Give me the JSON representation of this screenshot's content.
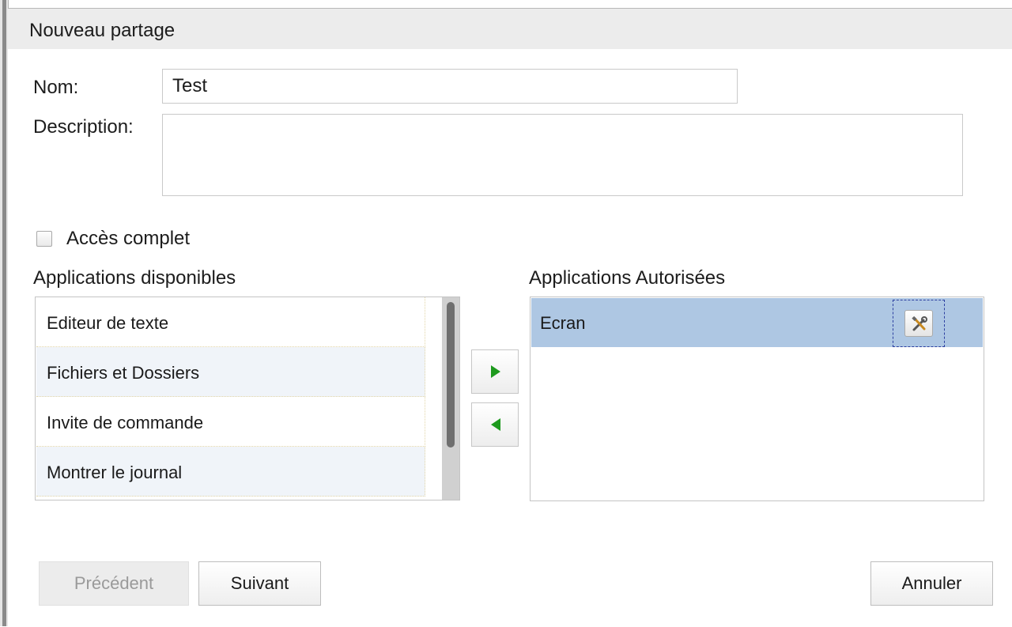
{
  "dialog": {
    "title": "Nouveau partage"
  },
  "form": {
    "name_label": "Nom:",
    "name_value": "Test",
    "description_label": "Description:",
    "description_value": "",
    "full_access_label": "Accès complet",
    "full_access_checked": false
  },
  "available": {
    "heading": "Applications disponibles",
    "items": [
      {
        "label": "Editeur de texte"
      },
      {
        "label": "Fichiers et Dossiers"
      },
      {
        "label": "Invite de commande"
      },
      {
        "label": "Montrer le journal"
      }
    ]
  },
  "authorized": {
    "heading": "Applications Autorisées",
    "items": [
      {
        "label": "Ecran",
        "selected": true
      }
    ]
  },
  "icons": {
    "add": "arrow-right-icon",
    "remove": "arrow-left-icon",
    "configure": "tools-icon"
  },
  "colors": {
    "arrow_green": "#1e9a1e",
    "selection": "#aec7e3"
  },
  "buttons": {
    "previous_label": "Précédent",
    "next_label": "Suivant",
    "cancel_label": "Annuler"
  }
}
